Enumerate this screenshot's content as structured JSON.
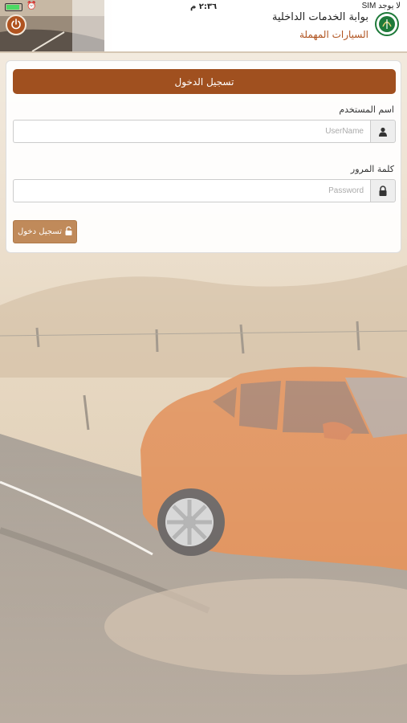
{
  "status_bar": {
    "carrier": "SIM لا يوجد",
    "time": "٢:٣٦ م"
  },
  "header": {
    "title": "بوابة الخدمات الداخلية",
    "subtitle": "السيارات المهملة",
    "logo_icon": "emblem-icon",
    "power_icon": "power-icon"
  },
  "login": {
    "heading": "تسجيل الدخول",
    "username_label": "اسم المستخدم",
    "username_placeholder": "UserName",
    "username_value": "",
    "password_label": "كلمة المرور",
    "password_placeholder": "Password",
    "password_value": "",
    "submit_label": "تسجيل دخول"
  },
  "colors": {
    "accent": "#a0501f",
    "button": "#c08a5a",
    "subtitle": "#b0531f"
  }
}
